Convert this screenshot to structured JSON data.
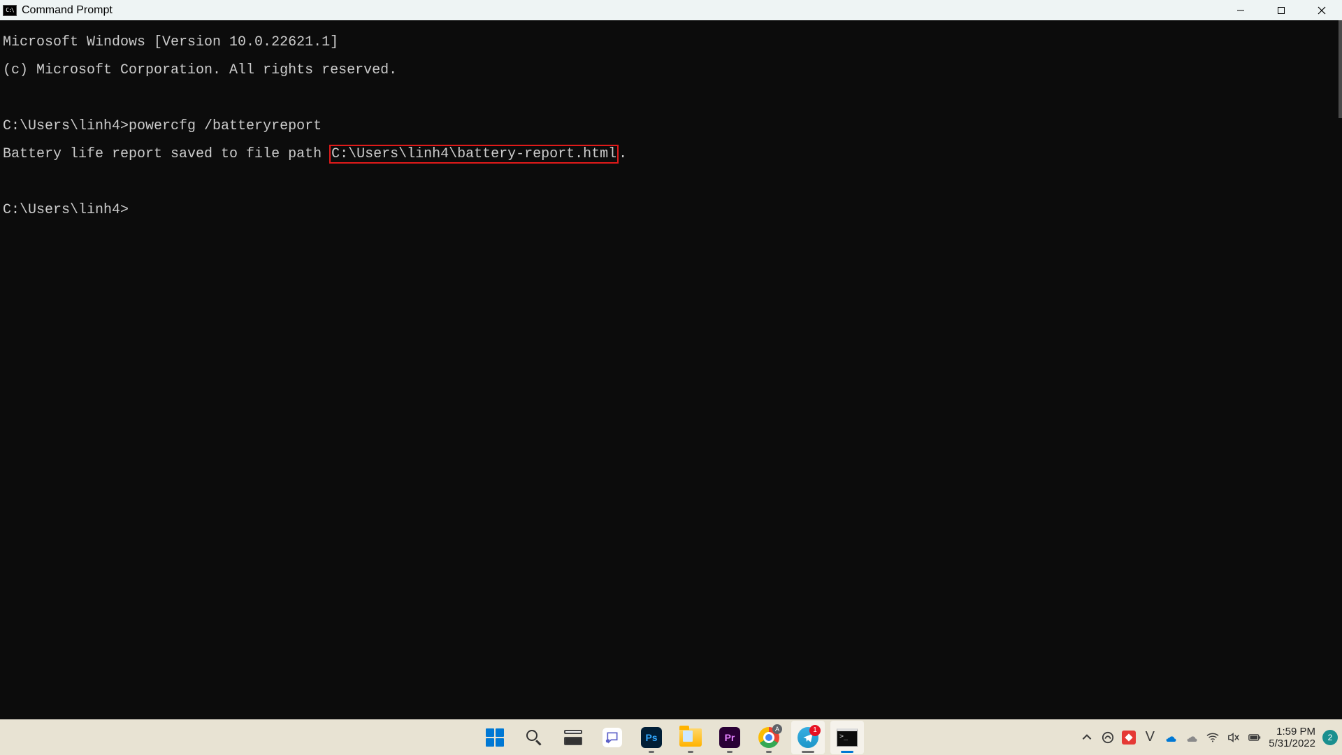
{
  "titlebar": {
    "icon_label": "C:\\",
    "title": "Command Prompt"
  },
  "terminal": {
    "line_version": "Microsoft Windows [Version 10.0.22621.1]",
    "line_copyright": "(c) Microsoft Corporation. All rights reserved.",
    "prompt1_path": "C:\\Users\\linh4>",
    "prompt1_cmd": "powercfg /batteryreport",
    "response_prefix": "Battery life report saved to file path ",
    "response_highlight": "C:\\Users\\linh4\\battery-report.html",
    "response_suffix": ".",
    "prompt2_path": "C:\\Users\\linh4>"
  },
  "taskbar": {
    "telegram_badge": "1",
    "clock_time": "1:59 PM",
    "clock_date": "5/31/2022",
    "notif_count": "2"
  },
  "tray": {
    "v_label": "V"
  }
}
